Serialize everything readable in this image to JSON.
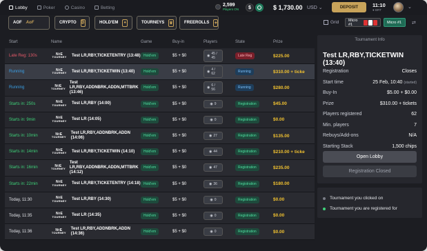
{
  "topnav": {
    "items": [
      {
        "label": "Lobby",
        "active": true
      },
      {
        "label": "Poker",
        "active": false
      },
      {
        "label": "Casino",
        "active": false
      },
      {
        "label": "Betting",
        "active": false
      }
    ]
  },
  "header": {
    "players_count": "2,599",
    "players_label": "Players ON",
    "currency_usd_icon": "$",
    "balance": "$ 1,730.00",
    "currency": "USD",
    "deposit_label": "DEPOSIT",
    "time": "11:10",
    "timezone": "BRT"
  },
  "filters": {
    "buttons": [
      {
        "label": "AOF",
        "icon": "AoF"
      },
      {
        "label": "CRYPTO",
        "icon": "₿"
      },
      {
        "label": "HOLD'EM",
        "icon": "♠"
      },
      {
        "label": "TOURNEYS",
        "icon": "🏆"
      },
      {
        "label": "FREEROLLS",
        "icon": "✦"
      }
    ],
    "grid_label": "Grid",
    "micro_a": "Micro #1",
    "micro_b": "Micro #1"
  },
  "table": {
    "headers": {
      "start": "Start",
      "name": "Name",
      "game": "Game",
      "buyin": "Buy-in",
      "players": "Players",
      "state": "State",
      "prize": "Prize"
    },
    "logo_top": "N◊E",
    "logo_bottom": "TOURNEY",
    "rows": [
      {
        "start": "Late Reg: 130s",
        "status": "late",
        "name": "Test LR,RBY,TICKETENTRY (13:48)",
        "game": "Hold'em",
        "buyin": "$5 + $0",
        "players": "45 / 45",
        "state": "Late Reg",
        "state_type": "late",
        "prize": "$225.00"
      },
      {
        "start": "Running",
        "status": "run",
        "name": "Test LR,RBY,TICKETWIN (13:40)",
        "game": "Hold'em",
        "buyin": "$5 + $0",
        "players": "4 / 62",
        "state": "Running",
        "state_type": "running",
        "prize": "$310.00 + ticke",
        "selected": true
      },
      {
        "start": "Running",
        "status": "run",
        "name": "Test LR,RBY,ADDNBRK,ADDN,MTTBRK (13:46)",
        "game": "Hold'em",
        "buyin": "$5 + $0",
        "players": "6 / 56",
        "state": "Running",
        "state_type": "running",
        "prize": "$280.00"
      },
      {
        "start": "Starts in: 250s",
        "status": "soon",
        "name": "Test LR,RBY (14:00)",
        "game": "Hold'em",
        "buyin": "$5 + $0",
        "players": "9",
        "state": "Registration",
        "state_type": "reg",
        "prize": "$45.00"
      },
      {
        "start": "Starts in: 9min",
        "status": "soon",
        "name": "Test LR (14:05)",
        "game": "Hold'em",
        "buyin": "$5 + $0",
        "players": "0",
        "state": "Registration",
        "state_type": "reg",
        "prize": "$0.00"
      },
      {
        "start": "Starts in: 10min",
        "status": "soon",
        "name": "Test LR,RBY,ADDNBRK,ADDN (14:06)",
        "game": "Hold'em",
        "buyin": "$5 + $0",
        "players": "27",
        "state": "Registration",
        "state_type": "reg",
        "prize": "$135.00"
      },
      {
        "start": "Starts in: 14min",
        "status": "soon",
        "name": "Test LR,RBY,TICKETWIN (14:10)",
        "game": "Hold'em",
        "buyin": "$5 + $0",
        "players": "44",
        "state": "Registration",
        "state_type": "reg",
        "prize": "$210.00 + ticke"
      },
      {
        "start": "Starts in: 16min",
        "status": "soon",
        "name": "Test LR,RBY,ADDNBRK,ADDN,MTTBRK (14:12)",
        "game": "Hold'em",
        "buyin": "$5 + $0",
        "players": "47",
        "state": "Registration",
        "state_type": "reg",
        "prize": "$235.00"
      },
      {
        "start": "Starts in: 22min",
        "status": "soon",
        "name": "Test LR,RBY,TICKETENTRY (14:18)",
        "game": "Hold'em",
        "buyin": "$5 + $0",
        "players": "36",
        "state": "Registration",
        "state_type": "reg",
        "prize": "$180.00"
      },
      {
        "start": "Today, 11:30",
        "status": "today",
        "name": "Test LR,RBY (14:30)",
        "game": "Hold'em",
        "buyin": "$5 + $0",
        "players": "0",
        "state": "Registration",
        "state_type": "reg",
        "prize": "$0.00"
      },
      {
        "start": "Today, 11:35",
        "status": "today",
        "name": "Test LR (14:35)",
        "game": "Hold'em",
        "buyin": "$5 + $0",
        "players": "0",
        "state": "Registration",
        "state_type": "reg",
        "prize": "$0.00"
      },
      {
        "start": "Today, 11:36",
        "status": "today",
        "name": "Test LR,RBY,ADDNBRK,ADDN (14:36)",
        "game": "Hold'em",
        "buyin": "$5 + $0",
        "players": "0",
        "state": "Registration",
        "state_type": "reg",
        "prize": "$0.00"
      }
    ]
  },
  "info": {
    "header": "Tournament Info",
    "title": "Test LR,RBY,TICKETWIN (13:40)",
    "rows": [
      {
        "k": "Registration",
        "v": "Closes",
        "note": ""
      },
      {
        "k": "Start time",
        "v": "25 Feb, 10:40",
        "note": "(started)"
      },
      {
        "k": "Buy-In",
        "v": "$5.00 + $0.00",
        "note": ""
      },
      {
        "k": "Prize",
        "v": "$310.00 + tickets",
        "note": ""
      },
      {
        "k": "Players registered",
        "v": "62",
        "note": ""
      },
      {
        "k": "Min. players",
        "v": "7",
        "note": ""
      },
      {
        "k": "Rebuys/Add-ons",
        "v": "N/A",
        "note": ""
      },
      {
        "k": "Starting Stack",
        "v": "1,500 chips",
        "note": ""
      }
    ],
    "open_lobby": "Open Lobby",
    "reg_closed": "Registration Closed"
  },
  "legend": {
    "items": [
      {
        "label": "Tournament you clicked on",
        "color": "#7a7d86"
      },
      {
        "label": "Tournament you are registered for",
        "color": "#3fd37a"
      }
    ]
  },
  "colors": {
    "accent": "#c8a35a",
    "late": "#e85b6a",
    "running": "#3aa0e6",
    "registration": "#3fd37a",
    "prize": "#f2c230"
  }
}
